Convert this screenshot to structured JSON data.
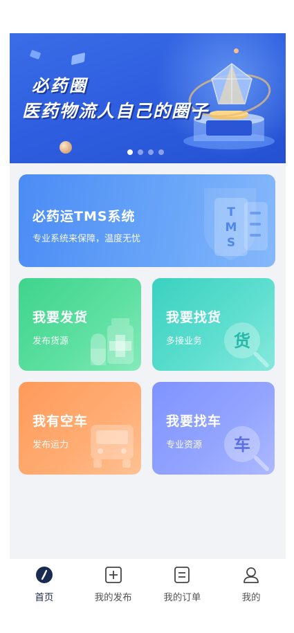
{
  "banner": {
    "title": "必药圈",
    "subtitle": "医药物流人自己的圈子",
    "slide_count": 4,
    "active_slide": 0
  },
  "cards": {
    "tms": {
      "title": "必药运TMS系统",
      "desc": "专业系统来保障，温度无忧",
      "icon_text": "TMS"
    },
    "send_goods": {
      "title": "我要发货",
      "desc": "发布货源"
    },
    "find_goods": {
      "title": "我要找货",
      "desc": "多接业务",
      "icon_text": "货"
    },
    "empty_car": {
      "title": "我有空车",
      "desc": "发布运力"
    },
    "find_car": {
      "title": "我要找车",
      "desc": "专业资源",
      "icon_text": "车"
    }
  },
  "tabbar": {
    "items": [
      {
        "label": "首页",
        "icon": "compass-icon",
        "active": true
      },
      {
        "label": "我的发布",
        "icon": "plus-square-icon",
        "active": false
      },
      {
        "label": "我的订单",
        "icon": "list-square-icon",
        "active": false
      },
      {
        "label": "我的",
        "icon": "user-icon",
        "active": false
      }
    ]
  },
  "colors": {
    "banner_blue": "#2f5fe0",
    "tms_blue": "#4b8cf5",
    "green": "#3ed48c",
    "teal": "#3bd1c0",
    "orange": "#ff9a5a",
    "purple": "#7f93ff",
    "tab_active": "#1a2b52"
  }
}
